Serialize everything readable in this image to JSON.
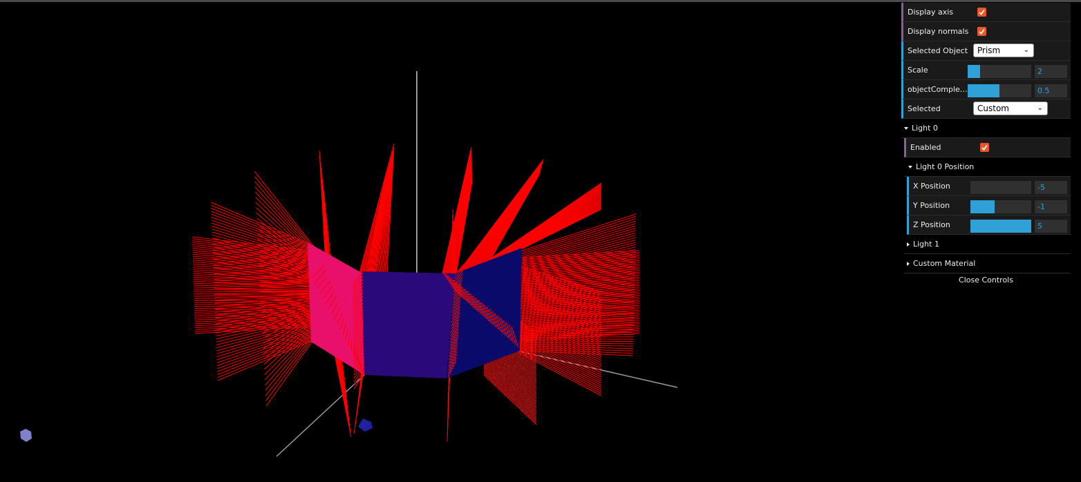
{
  "gui": {
    "display_axis": {
      "label": "Display axis",
      "checked": true
    },
    "display_normals": {
      "label": "Display normals",
      "checked": true
    },
    "selected_object": {
      "label": "Selected Object",
      "value": "Prism"
    },
    "scale": {
      "label": "Scale",
      "value": "2",
      "fraction": 0.2
    },
    "object_complexity": {
      "label": "objectComplex…",
      "value": "0.5",
      "fraction": 0.5
    },
    "selected_material": {
      "label": "Selected",
      "value": "Custom"
    },
    "light0": {
      "title": "Light 0",
      "enabled": {
        "label": "Enabled",
        "checked": true
      },
      "position": {
        "title": "Light 0 Position",
        "x": {
          "label": "X Position",
          "value": "-5",
          "fraction": 0.0
        },
        "y": {
          "label": "Y Position",
          "value": "-1",
          "fraction": 0.4
        },
        "z": {
          "label": "Z Position",
          "value": "5",
          "fraction": 1.0
        }
      }
    },
    "light1": {
      "title": "Light 1"
    },
    "custom_material": {
      "title": "Custom Material"
    },
    "close_label": "Close Controls"
  },
  "colors": {
    "accent": "#2fa1d6",
    "checkbox": "#e8572a",
    "normals": "#ff0000",
    "face_left": "#e8106a",
    "face_front": "#2a0a7a",
    "face_right": "#0a0a6a"
  }
}
